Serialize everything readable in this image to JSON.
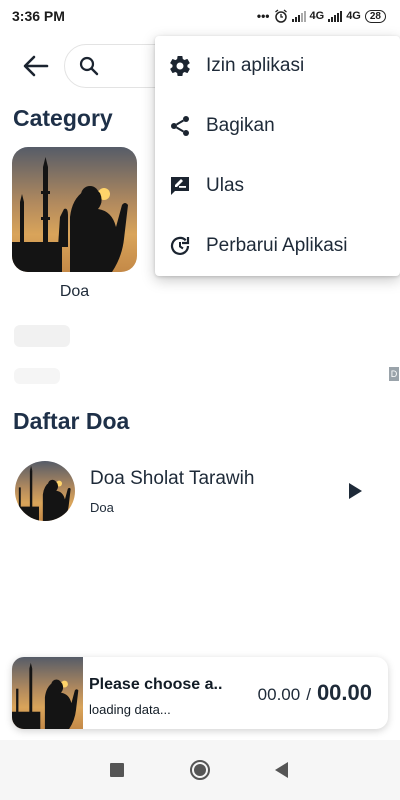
{
  "status_bar": {
    "time": "3:36 PM",
    "dots": "•••",
    "network1": "4G",
    "network2": "4G",
    "network2_suffix": "ıl",
    "battery": "28"
  },
  "header": {
    "back_icon": "arrow-left-icon",
    "search_icon": "search-icon"
  },
  "menu": {
    "items": [
      {
        "label": "Izin aplikasi",
        "icon": "gear-icon"
      },
      {
        "label": "Bagikan",
        "icon": "share-icon"
      },
      {
        "label": "Ulas",
        "icon": "rate-review-icon"
      },
      {
        "label": "Perbarui Aplikasi",
        "icon": "update-icon"
      }
    ]
  },
  "category": {
    "title": "Category",
    "items": [
      {
        "label": "Doa"
      }
    ]
  },
  "ad": {
    "badge": "D"
  },
  "daftar": {
    "title": "Daftar Doa",
    "items": [
      {
        "title": "Doa Sholat Tarawih",
        "subtitle": "Doa"
      }
    ]
  },
  "player": {
    "title": "Please choose a..",
    "status": "loading data...",
    "current_time": "00.00",
    "separator": "/",
    "total_time": "00.00"
  },
  "colors": {
    "heading": "#1e3048",
    "text": "#1e2a38",
    "sky_top": "#5e6470",
    "sky_glow": "#d9a45a",
    "sun": "#ffd46a"
  }
}
